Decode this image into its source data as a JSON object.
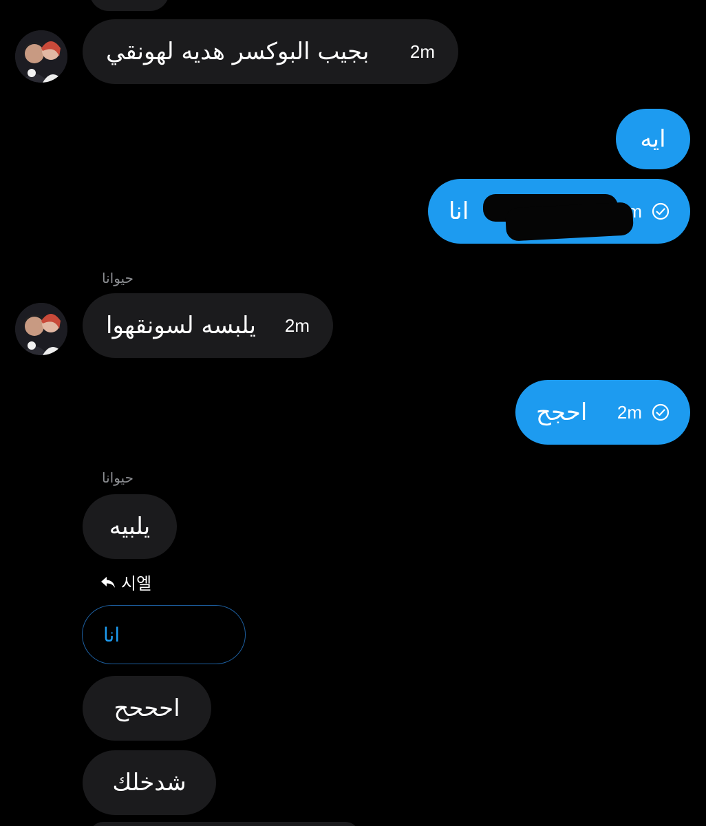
{
  "thread": {
    "messages": [
      {
        "text": "بجيب البوكسر هديه لهونقي",
        "time": "2m"
      },
      {
        "text": "ايه"
      },
      {
        "text": "انا",
        "time": "2m"
      },
      {
        "sender": "حيوانا",
        "text": "يلبسه لسونقهوا",
        "time": "2m"
      },
      {
        "text": "احجح",
        "time": "2m"
      },
      {
        "sender": "حيوانا",
        "text": "يلبيه"
      },
      {
        "reply_to": "시엘",
        "quoted": "انا"
      },
      {
        "text": "احححح"
      },
      {
        "text": "شدخلك"
      }
    ]
  },
  "colors": {
    "background": "#000000",
    "incoming_bubble": "#1b1b1d",
    "outgoing_bubble": "#1d9bf0",
    "sender_name": "#8b8d91"
  },
  "icons": {
    "sent_status": "check-circle-icon",
    "reply": "reply-arrow-icon"
  }
}
